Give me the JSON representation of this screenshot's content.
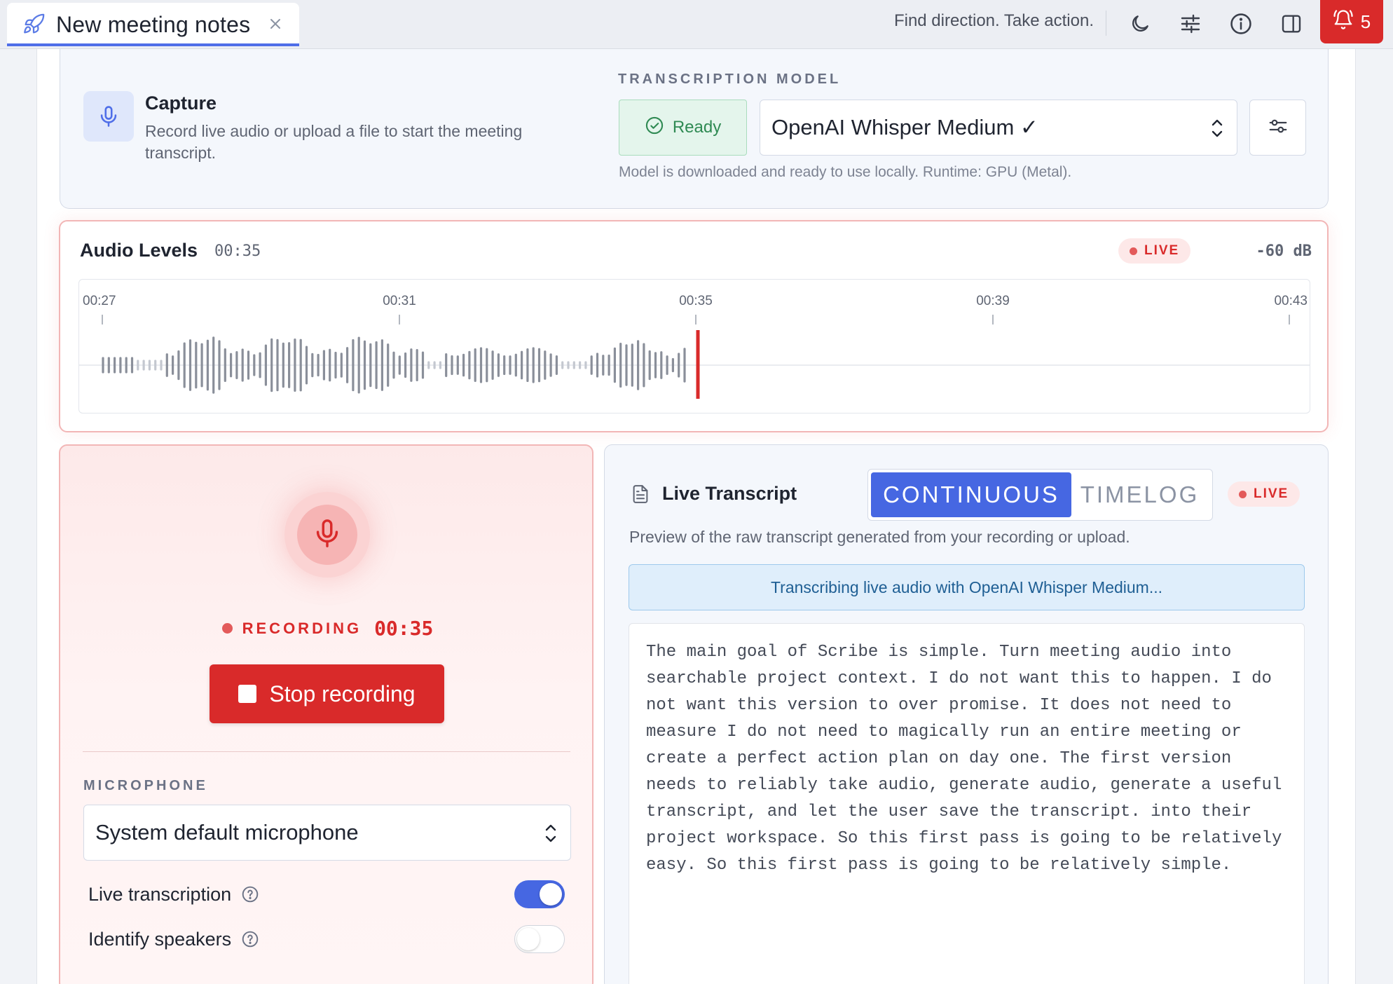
{
  "tab": {
    "title": "New meeting notes",
    "icon": "rocket-icon"
  },
  "topbar": {
    "tagline": "Find direction. Take action.",
    "icons": [
      "moon-icon",
      "sliders-icon",
      "info-icon",
      "sidebar-icon",
      "bell-icon"
    ],
    "notifications_count": "5"
  },
  "capture": {
    "title": "Capture",
    "description": "Record live audio or upload a file to start the meeting transcript.",
    "model_label": "TRANSCRIPTION MODEL",
    "status": "Ready",
    "model_selected": "OpenAI Whisper Medium ✓",
    "note": "Model is downloaded and ready to use locally. Runtime: GPU (Metal)."
  },
  "audio": {
    "title": "Audio Levels",
    "time": "00:35",
    "live": "LIVE",
    "db": "-60 dB",
    "ticks": [
      "00:27",
      "00:31",
      "00:35",
      "00:39",
      "00:43"
    ],
    "playhead_time": "00:35"
  },
  "recorder": {
    "status_label": "RECORDING",
    "time": "00:35",
    "stop_label": "Stop recording",
    "microphone_label": "MICROPHONE",
    "microphone_selected": "System default microphone",
    "options": [
      {
        "label": "Live transcription",
        "enabled": true
      },
      {
        "label": "Identify speakers",
        "enabled": false
      }
    ]
  },
  "transcript": {
    "title": "Live Transcript",
    "modes": [
      "CONTINUOUS",
      "TIMELOG"
    ],
    "active_mode": "CONTINUOUS",
    "live": "LIVE",
    "description": "Preview of the raw transcript generated from your recording or upload.",
    "banner": "Transcribing live audio with OpenAI Whisper Medium...",
    "text": "The main goal of Scribe is simple. Turn meeting audio into searchable project context. I do not want this to happen. I do not want this version to over promise. It does not need to measure I do not need to magically run an entire meeting or create a perfect action plan on day one. The first version needs to reliably take audio, generate audio, generate a useful transcript, and let the user save the transcript. into their project workspace. So this first pass is going to be relatively easy. So this first pass is going to be relatively simple."
  },
  "colors": {
    "accent": "#4667e2",
    "danger": "#d92a2a",
    "ready": "#2f8a53",
    "info_banner": "#dfeefb"
  }
}
